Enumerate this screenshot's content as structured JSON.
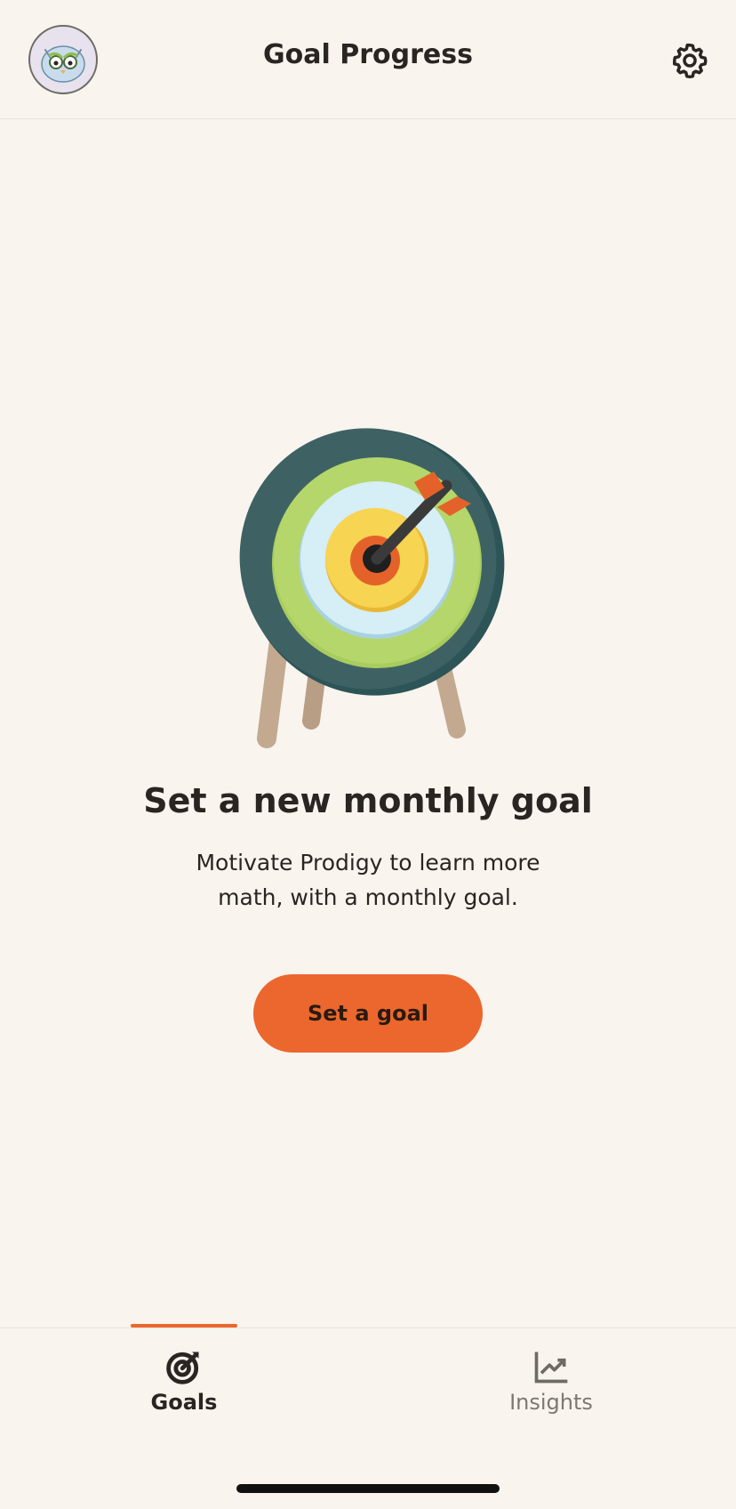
{
  "header": {
    "title": "Goal Progress",
    "avatar_icon": "owl-avatar-icon",
    "settings_icon": "gear-icon"
  },
  "main": {
    "illustration_icon": "target-with-arrow-icon",
    "headline": "Set a new monthly goal",
    "subtitle": "Motivate Prodigy to learn more math, with a monthly goal.",
    "cta_label": "Set a goal"
  },
  "tabbar": {
    "tabs": [
      {
        "label": "Goals",
        "icon": "target-icon",
        "active": true
      },
      {
        "label": "Insights",
        "icon": "chart-trend-icon",
        "active": false
      }
    ]
  },
  "colors": {
    "background": "#f9f4ee",
    "accent": "#ec672d",
    "text": "#2a2522",
    "muted": "#7d7772"
  }
}
